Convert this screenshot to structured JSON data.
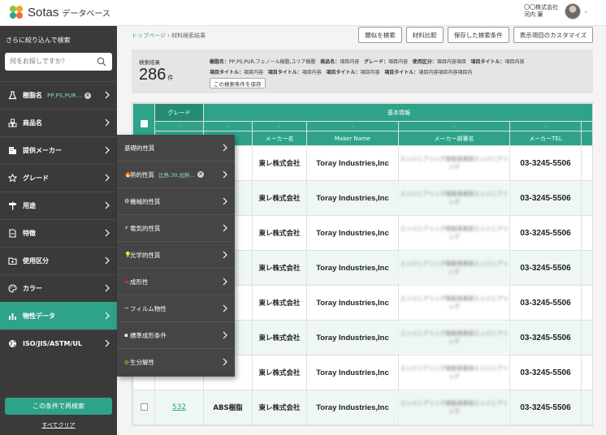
{
  "header": {
    "logo_name": "Sotas",
    "logo_sub": "データベース",
    "company": "〇〇株式会社",
    "user_name": "河内 廉"
  },
  "sidebar": {
    "title": "さらに絞り込んで検索",
    "search_placeholder": "何をお探しですか？",
    "items": [
      {
        "label": "樹脂名",
        "selected": "PP,PS,PUR…",
        "icon": "flask-icon"
      },
      {
        "label": "商品名",
        "icon": "box-group-icon"
      },
      {
        "label": "提供メーカー",
        "icon": "building-icon"
      },
      {
        "label": "グレード",
        "icon": "star-icon"
      },
      {
        "label": "用途",
        "icon": "signpost-icon"
      },
      {
        "label": "特徴",
        "icon": "document-icon"
      },
      {
        "label": "使用区分",
        "icon": "folder-icon"
      },
      {
        "label": "カラー",
        "icon": "palette-icon"
      },
      {
        "label": "物性データ",
        "icon": "bar-chart-icon"
      },
      {
        "label": "ISO/JIS/ASTM/UL",
        "icon": "globe-icon"
      }
    ],
    "search_button": "この条件で再検索",
    "clear_all": "すべてクリア"
  },
  "flyout": {
    "items": [
      {
        "label": "基礎的性質",
        "icon": ""
      },
      {
        "label": "熱的性質",
        "icon": "🔥",
        "selected": "比熱:30,加熱…"
      },
      {
        "label": "機械的性質",
        "icon": "⚙"
      },
      {
        "label": "電気的性質",
        "icon": "⚡"
      },
      {
        "label": "光学的性質",
        "icon": "💡"
      },
      {
        "label": "成形性",
        "icon": "▬"
      },
      {
        "label": "フィルム物性",
        "icon": "~"
      },
      {
        "label": "標準成形条件",
        "icon": "▪"
      },
      {
        "label": "生分解性",
        "icon": "✿"
      }
    ]
  },
  "breadcrumb": {
    "home": "トップページ",
    "separator": "›",
    "current": "材料検索結果"
  },
  "toolbar": {
    "buttons": [
      "類似を検索",
      "材料比較",
      "保存した検索条件",
      "表示項目のカスタマイズ"
    ]
  },
  "results": {
    "label": "検索結果",
    "count": "286",
    "unit": "件",
    "conditions_line1": [
      {
        "k": "樹脂名：",
        "v": "PP,PS,PUR,フェノール樹脂,ユリア樹脂"
      },
      {
        "k": "商品名：",
        "v": "項目内容"
      },
      {
        "k": "グレード：",
        "v": "項目内容"
      },
      {
        "k": "使用区分：",
        "v": "項目内容項目"
      },
      {
        "k": "項目タイトル：",
        "v": "項目内容"
      }
    ],
    "conditions_line2": [
      {
        "k": "項目タイトル：",
        "v": "項目内容"
      },
      {
        "k": "項目タイトル：",
        "v": "項目内容"
      },
      {
        "k": "項目タイトル：",
        "v": "項目内容"
      },
      {
        "k": "項目タイトル：",
        "v": "項目内容項目内容項目内"
      }
    ],
    "save_button": "この検索条件を保存"
  },
  "table": {
    "group_grade": "グレード",
    "group_basic": "基本情報",
    "sub_dash": "-",
    "columns": [
      "",
      "",
      "",
      "メーカー名",
      "Maker Name",
      "メーカー部署名",
      "メーカーTEL"
    ],
    "rows": [
      {
        "id": "",
        "resin": "脂",
        "maker": "東レ株式会社",
        "maker_en": "Toray Industries,Inc",
        "dept": "エンジニアリング樹脂事業部エンジニアリング",
        "tel": "03-3245-5506"
      },
      {
        "id": "",
        "resin": "脂",
        "maker": "東レ株式会社",
        "maker_en": "Toray Industries,Inc",
        "dept": "エンジニアリング樹脂事業部エンジニアリング",
        "tel": "03-3245-5506"
      },
      {
        "id": "",
        "resin": "脂",
        "maker": "東レ株式会社",
        "maker_en": "Toray Industries,Inc",
        "dept": "エンジニアリング樹脂事業部エンジニアリング",
        "tel": "03-3245-5506"
      },
      {
        "id": "",
        "resin": "脂",
        "maker": "東レ株式会社",
        "maker_en": "Toray Industries,Inc",
        "dept": "エンジニアリング樹脂事業部エンジニアリング",
        "tel": "03-3245-5506"
      },
      {
        "id": "",
        "resin": "脂",
        "maker": "東レ株式会社",
        "maker_en": "Toray Industries,Inc",
        "dept": "エンジニアリング樹脂事業部エンジニアリング",
        "tel": "03-3245-5506"
      },
      {
        "id": "",
        "resin": "脂",
        "maker": "東レ株式会社",
        "maker_en": "Toray Industries,Inc",
        "dept": "エンジニアリング樹脂事業部エンジニアリング",
        "tel": "03-3245-5506"
      },
      {
        "id": "",
        "resin": "脂",
        "maker": "東レ株式会社",
        "maker_en": "Toray Industries,Inc",
        "dept": "エンジニアリング樹脂事業部エンジニアリング",
        "tel": "03-3245-5506"
      },
      {
        "id": "532",
        "resin": "ABS樹脂",
        "maker": "東レ株式会社",
        "maker_en": "Toray Industries,Inc",
        "dept": "エンジニアリング樹脂事業部エンジニアリング",
        "tel": "03-3245-5506"
      }
    ]
  },
  "colors": {
    "accent": "#2ea389",
    "sidebar_bg": "#3a3a3a",
    "flyout_bg": "#454545"
  }
}
